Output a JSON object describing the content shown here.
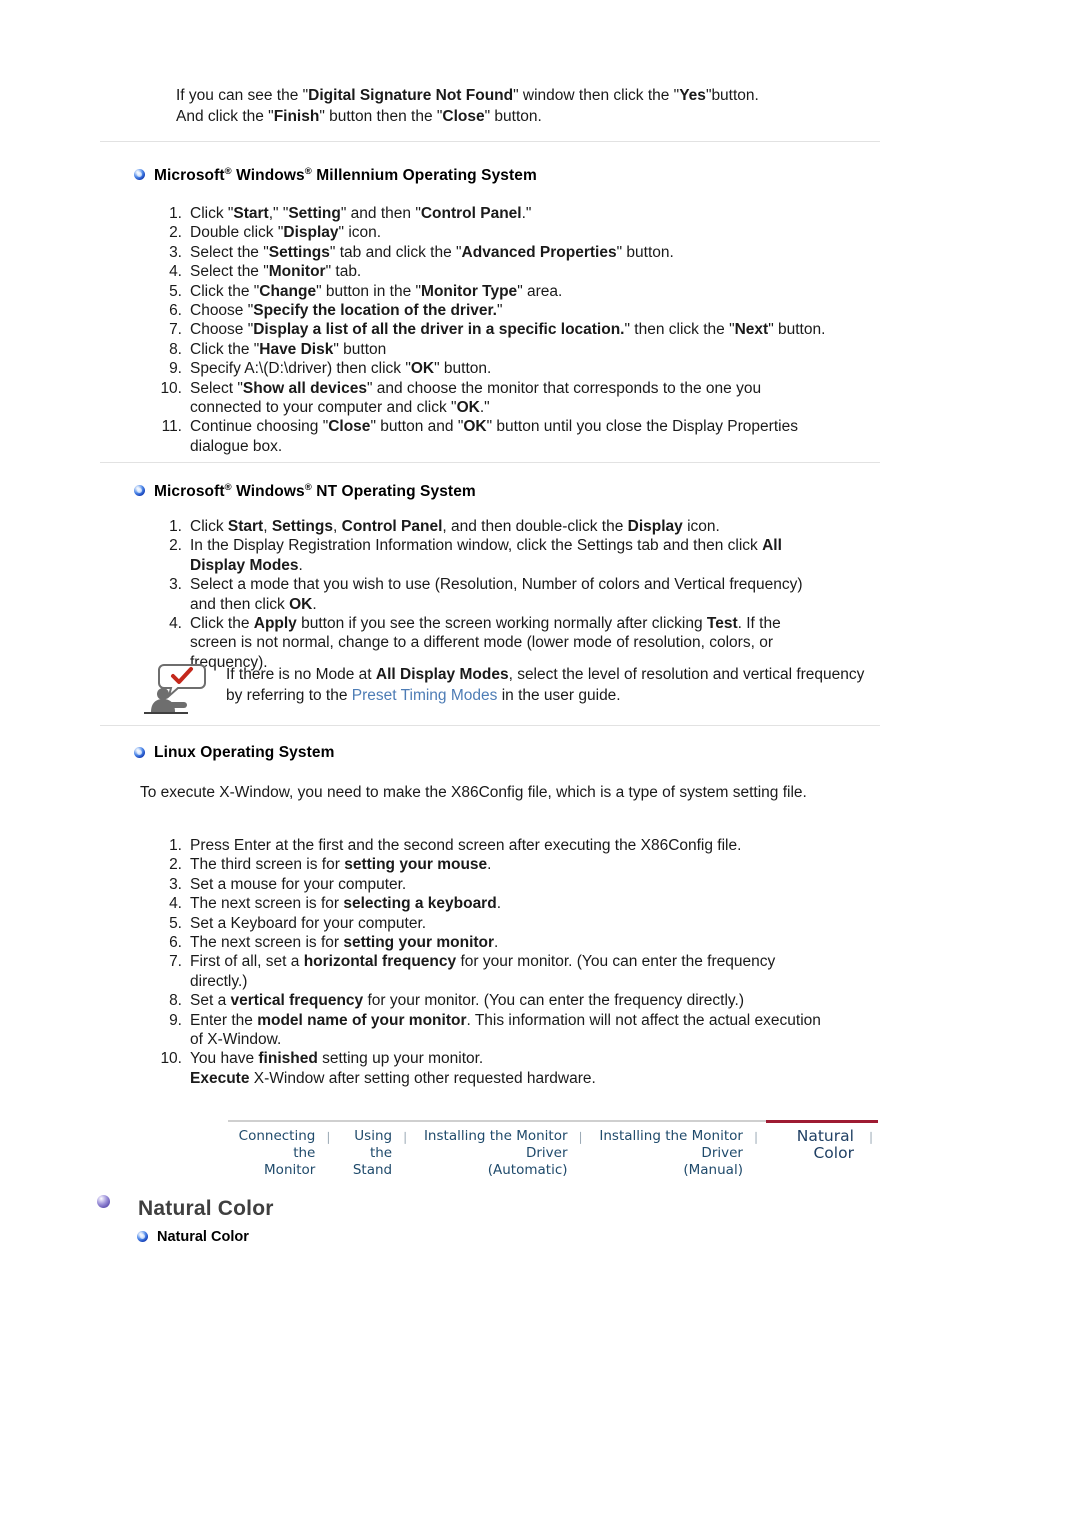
{
  "intro": {
    "line1_a": "If you can see the \"",
    "line1_b": "Digital Signature Not Found",
    "line1_c": "\" window then click the \"",
    "line1_d": "Yes",
    "line1_e": "\"button.",
    "line2_a": "And click the \"",
    "line2_b": "Finish",
    "line2_c": "\" button then the \"",
    "line2_d": "Close",
    "line2_e": "\" button."
  },
  "sections": {
    "millennium": {
      "heading_part1": "Microsoft",
      "heading_sup1": "®",
      "heading_part2": " Windows",
      "heading_sup2": "®",
      "heading_part3": " Millennium Operating System",
      "steps": [
        {
          "num": "1.",
          "html": "Click \"<b>Start</b>,\" \"<b>Setting</b>\" and then \"<b>Control Panel</b>.\""
        },
        {
          "num": "2.",
          "html": "Double click \"<b>Display</b>\" icon."
        },
        {
          "num": "3.",
          "html": "Select the \"<b>Settings</b>\" tab and click the \"<b>Advanced Properties</b>\" button."
        },
        {
          "num": "4.",
          "html": "Select the \"<b>Monitor</b>\" tab."
        },
        {
          "num": "5.",
          "html": "Click the \"<b>Change</b>\" button in the \"<b>Monitor Type</b>\" area."
        },
        {
          "num": "6.",
          "html": "Choose \"<b>Specify the location of the driver.</b>\""
        },
        {
          "num": "7.",
          "html": "Choose \"<b>Display a list of all the driver in a specific location.</b>\" then click the \"<b>Next</b>\" button."
        },
        {
          "num": "8.",
          "html": "Click the \"<b>Have Disk</b>\" button"
        },
        {
          "num": "9.",
          "html": "Specify A:\\(D:\\driver) then click \"<b>OK</b>\" button."
        },
        {
          "num": "10.",
          "html": "Select \"<b>Show all devices</b>\" and choose the monitor that corresponds to the one you<br>connected to your computer and click \"<b>OK</b>.\""
        },
        {
          "num": "11.",
          "html": "Continue choosing \"<b>Close</b>\" button and \"<b>OK</b>\" button until you close the Display Properties<br>dialogue box."
        }
      ]
    },
    "nt": {
      "heading_part1": "Microsoft",
      "heading_sup1": "®",
      "heading_part2": " Windows",
      "heading_sup2": "®",
      "heading_part3": " NT Operating System",
      "steps": [
        {
          "num": "1.",
          "html": "Click <b>Start</b>, <b>Settings</b>, <b>Control Panel</b>, and then double-click the <b>Display</b> icon."
        },
        {
          "num": "2.",
          "html": "In the Display Registration Information window, click the Settings tab and then click <b>All</b><br><b>Display Modes</b>."
        },
        {
          "num": "3.",
          "html": "Select a mode that you wish to use (Resolution, Number of colors and Vertical frequency)<br>and then click <b>OK</b>."
        },
        {
          "num": "4.",
          "html": "Click the <b>Apply</b> button if you see the screen working normally after clicking <b>Test</b>. If the<br>screen is not normal, change to a different mode (lower mode of resolution, colors, or<br>frequency)."
        }
      ],
      "note": {
        "text_a": "If there is no Mode at ",
        "text_b": "All Display Modes",
        "text_c": ", select the level of resolution and vertical frequency by referring to the ",
        "link": "Preset Timing Modes",
        "text_d": " in the user guide."
      }
    },
    "linux": {
      "heading": "Linux Operating System",
      "paragraph": "To execute X-Window, you need to make the X86Config file, which is a type of system setting file.",
      "steps": [
        {
          "num": "1.",
          "html": "Press Enter at the first and the second screen after executing the X86Config file."
        },
        {
          "num": "2.",
          "html": "The third screen is for <b>setting your mouse</b>."
        },
        {
          "num": "3.",
          "html": "Set a mouse for your computer."
        },
        {
          "num": "4.",
          "html": "The next screen is for <b>selecting a keyboard</b>."
        },
        {
          "num": "5.",
          "html": "Set a Keyboard for your computer."
        },
        {
          "num": "6.",
          "html": "The next screen is for <b>setting your monitor</b>."
        },
        {
          "num": "7.",
          "html": "First of all, set a <b>horizontal frequency</b> for your monitor. (You can enter the frequency<br>directly.)"
        },
        {
          "num": "8.",
          "html": "Set a <b>vertical frequency</b> for your monitor. (You can enter the frequency directly.)"
        },
        {
          "num": "9.",
          "html": "Enter the <b>model name of your monitor</b>. This information will not affect the actual execution<br>of X-Window."
        },
        {
          "num": "10.",
          "html": "You have <b>finished</b> setting up your monitor.<br><b>Execute</b> X-Window after setting other requested hardware."
        }
      ]
    }
  },
  "tabbar": {
    "tabs": [
      {
        "label": "Connecting  the\nMonitor",
        "active": false
      },
      {
        "label": "Using the\nStand",
        "active": false
      },
      {
        "label": "Installing the Monitor Driver\n(Automatic)",
        "active": false
      },
      {
        "label": "Installing the Monitor Driver\n(Manual)",
        "active": false
      },
      {
        "label": "Natural Color",
        "active": true
      }
    ],
    "separator": "❘",
    "active_accent_color": "#9e1b32"
  },
  "natural_color": {
    "title": "Natural Color",
    "subtitle": "Natural Color"
  }
}
